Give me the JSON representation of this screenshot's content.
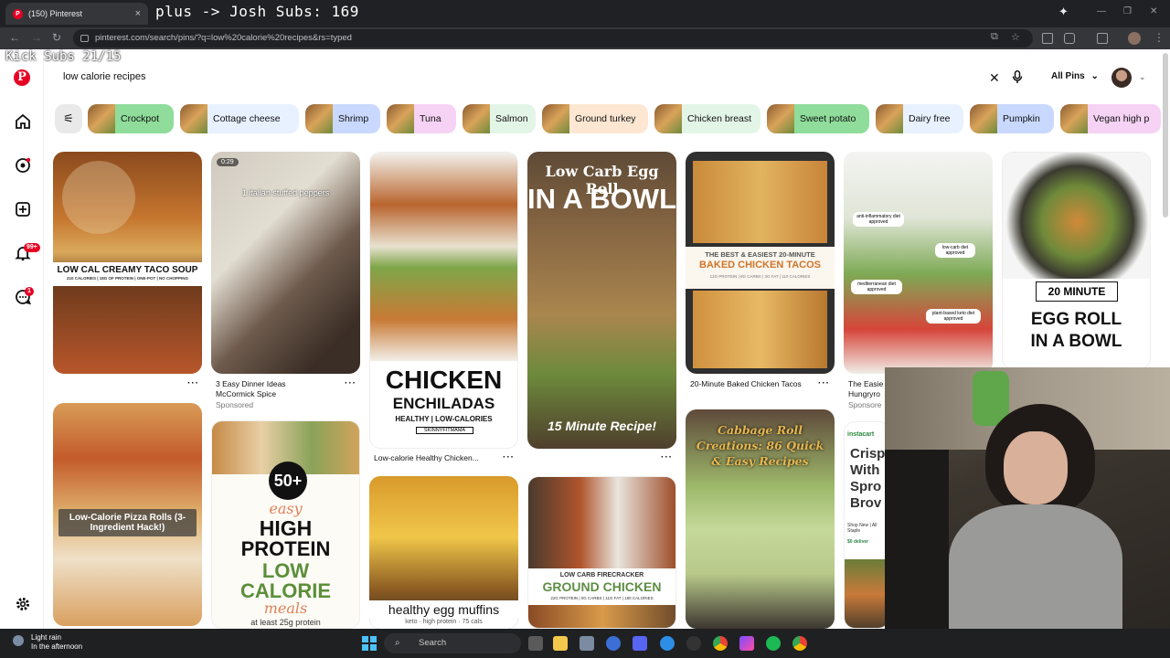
{
  "browser": {
    "tab_title": "(150) Pinterest",
    "url": "pinterest.com/search/pins/?q=low%20calorie%20recipes&rs=typed"
  },
  "overlays": {
    "top": "plus ->  Josh Subs: 169",
    "kick": "Kick Subs 21/15"
  },
  "rail": {
    "notif_badge": "99+",
    "msg_badge": "1"
  },
  "search": {
    "query": "low calorie recipes",
    "scope": "All Pins"
  },
  "chips": [
    {
      "label": "Crockpot",
      "color": "#8fdc9b"
    },
    {
      "label": "Cottage cheese",
      "color": "#e8f1ff"
    },
    {
      "label": "Shrimp",
      "color": "#c9d8ff"
    },
    {
      "label": "Tuna",
      "color": "#f6d2f4"
    },
    {
      "label": "Salmon",
      "color": "#e3f5e7"
    },
    {
      "label": "Ground turkey",
      "color": "#fde7d3"
    },
    {
      "label": "Chicken breast",
      "color": "#e3f5e7"
    },
    {
      "label": "Sweet potato",
      "color": "#8fdc9b"
    },
    {
      "label": "Dairy free",
      "color": "#e8f1ff"
    },
    {
      "label": "Pumpkin",
      "color": "#c9d8ff"
    },
    {
      "label": "Vegan high p",
      "color": "#f6d2f4"
    }
  ],
  "pins": {
    "taco_soup_title": "LOW CAL CREAMY TACO SOUP",
    "taco_soup_sub": "210 CALORIES | 18G OF PROTEIN | ONE-POT | NO CHOPPING",
    "video_time": "0:29",
    "video_caption": "1 italian stuffed peppers",
    "dinner_title": "3 Easy Dinner Ideas",
    "dinner_brand": "McCormick Spice",
    "sponsored": "Sponsored",
    "ench_big": "CHICKEN",
    "ench_mid": "ENCHILADAS",
    "ench_small": "HEALTHY | LOW-CALORIES",
    "ench_brand": "SKINNYFITMAMA",
    "ench_caption": "Low-calorie Healthy Chicken...",
    "eggroll_l1": "Low Carb Egg Roll",
    "eggroll_l2": "IN A BOWL",
    "eggroll_l3": "15 Minute Recipe!",
    "tacos_small": "THE BEST & EASIEST 20-MINUTE",
    "tacos_big": "BAKED CHICKEN TACOS",
    "tacos_macros": "12G PROTEIN | 8G CARBS | 3G FAT | 110 CALORIES",
    "tacos_caption": "20-Minute Baked Chicken Tacos",
    "bowl_tag1": "anti-inflammatory diet approved",
    "bowl_tag2": "low-carb diet approved",
    "bowl_tag3": "mediterranean diet approved",
    "bowl_tag4": "plant-based keto diet approved",
    "bowl_caption": "The Easie",
    "bowl_brand": "Hungryro",
    "bowl_sponsored": "Sponsore",
    "egg20_l1": "20 MINUTE",
    "egg20_l2": "EGG ROLL",
    "egg20_l3": "IN A BOWL",
    "pizza_text": "Low-Calorie Pizza Rolls (3-Ingredient Hack!)",
    "hp_num": "50+",
    "hp_easy": "easy",
    "hp_high": "HIGH",
    "hp_protein": "PROTEIN",
    "hp_low": "LOW",
    "hp_calorie": "CALORIE",
    "hp_meals": "meals",
    "hp_least": "at least 25g protein",
    "muffins_title": "healthy egg muffins",
    "muffins_sub": "keto · high protein · 75 cals",
    "ground_small": "LOW CARB FIRECRACKER",
    "ground_big": "GROUND CHICKEN",
    "ground_macros": "22G PROTEIN | 0G CARBS | 11G FAT | 180 CALORIES",
    "cabbage_text": "Cabbage Roll Creations: 86 Quick & Easy Recipes",
    "insta_brand": "instacart",
    "insta_text": "Crisp With Spro Brov",
    "insta_small": "Shop New | All Staple",
    "insta_deliv": "$0 deliver"
  },
  "taskbar": {
    "weather_temp": "Light rain",
    "weather_sub": "In the afternoon",
    "search": "Search"
  }
}
